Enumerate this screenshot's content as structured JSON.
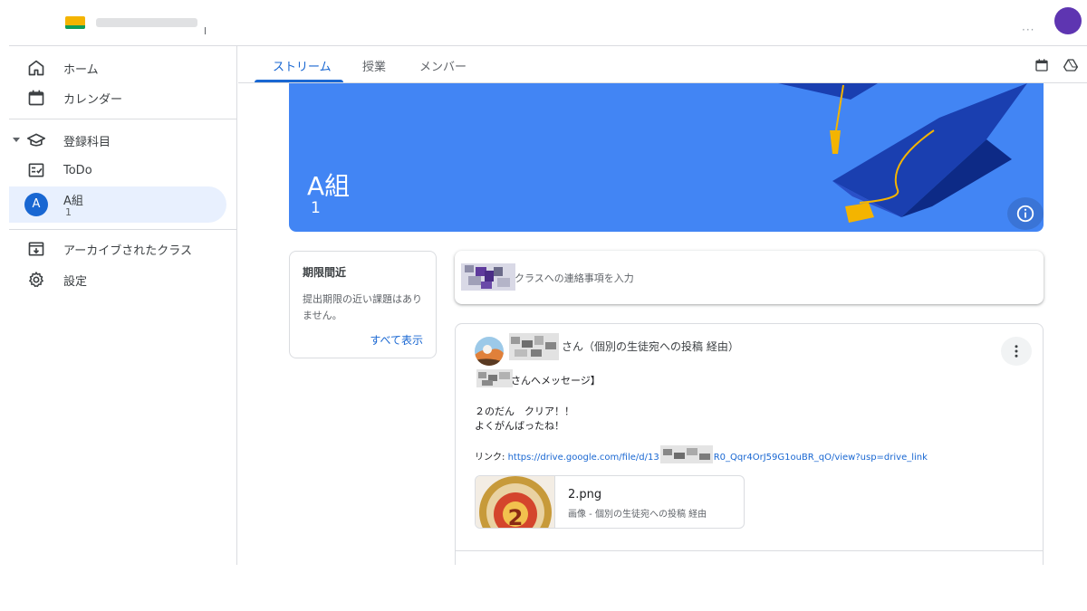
{
  "sidebar": {
    "items": [
      {
        "label": "ホーム",
        "icon": "home-icon"
      },
      {
        "label": "カレンダー",
        "icon": "calendar-icon"
      },
      {
        "label": "登録科目",
        "icon": "school-icon"
      },
      {
        "label": "ToDo",
        "icon": "todo-checklist-icon"
      },
      {
        "label": "A組",
        "section": "1",
        "avatar_letter": "A"
      },
      {
        "label": "アーカイブされたクラス",
        "icon": "archive-icon"
      },
      {
        "label": "設定",
        "icon": "gear-icon"
      }
    ]
  },
  "tabs": [
    {
      "label": "ストリーム",
      "active": true
    },
    {
      "label": "授業"
    },
    {
      "label": "メンバー"
    }
  ],
  "banner": {
    "title": "A組",
    "section": "1",
    "color": "#4285f4"
  },
  "upcoming": {
    "title": "期限間近",
    "body": "提出期限の近い課題はありません。",
    "view_all": "すべて表示"
  },
  "announce": {
    "placeholder": "クラスへの連絡事項を入力"
  },
  "post": {
    "author_suffix": "さん（個別の生徒宛への投稿 経由）",
    "line1": "さんへメッセージ】",
    "line2": "２のだん　クリア！！",
    "line3": "よくがんばったね！",
    "link_label": "リンク: ",
    "link_prefix": "https://drive.google.com/file/d/13",
    "link_suffix": "R0_Qqr4OrJ59G1ouBR_qO/view?usp=drive_link",
    "attachment": {
      "name": "2.png",
      "meta": "画像 - 個別の生徒宛への投稿 経由",
      "thumb_digit": "2"
    }
  },
  "colors": {
    "accent": "#1967d2",
    "selected_bg": "#e8f0fe"
  }
}
